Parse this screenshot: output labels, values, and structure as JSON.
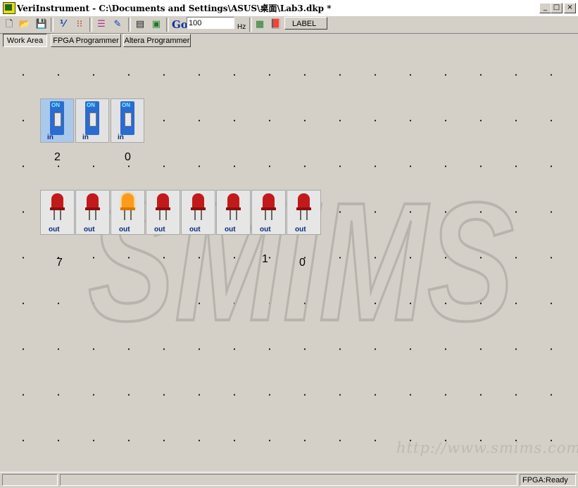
{
  "window": {
    "title": "VeriInstrument - C:\\Documents and Settings\\ASUS\\桌面\\Lab3.dkp *"
  },
  "toolbar": {
    "go_label": "Go",
    "frequency_value": "100",
    "frequency_unit": "Hz",
    "label_button": "LABEL"
  },
  "tabs": [
    "Work Area",
    "FPGA Programmer",
    "Altera Programmer"
  ],
  "switches": [
    {
      "on_text": "ON",
      "dir": "in"
    },
    {
      "on_text": "ON",
      "dir": "in"
    },
    {
      "on_text": "ON",
      "dir": "in"
    }
  ],
  "switch_labels": [
    "2",
    "0"
  ],
  "leds": [
    {
      "dir": "out",
      "lit": false
    },
    {
      "dir": "out",
      "lit": false
    },
    {
      "dir": "out",
      "lit": true
    },
    {
      "dir": "out",
      "lit": false
    },
    {
      "dir": "out",
      "lit": false
    },
    {
      "dir": "out",
      "lit": false
    },
    {
      "dir": "out",
      "lit": false
    },
    {
      "dir": "out",
      "lit": false
    }
  ],
  "led_labels": [
    "7",
    "1",
    "0"
  ],
  "watermark": {
    "logo": "SMIMS",
    "url": "http://www.smims.com"
  },
  "status": {
    "right": "FPGA:Ready"
  }
}
